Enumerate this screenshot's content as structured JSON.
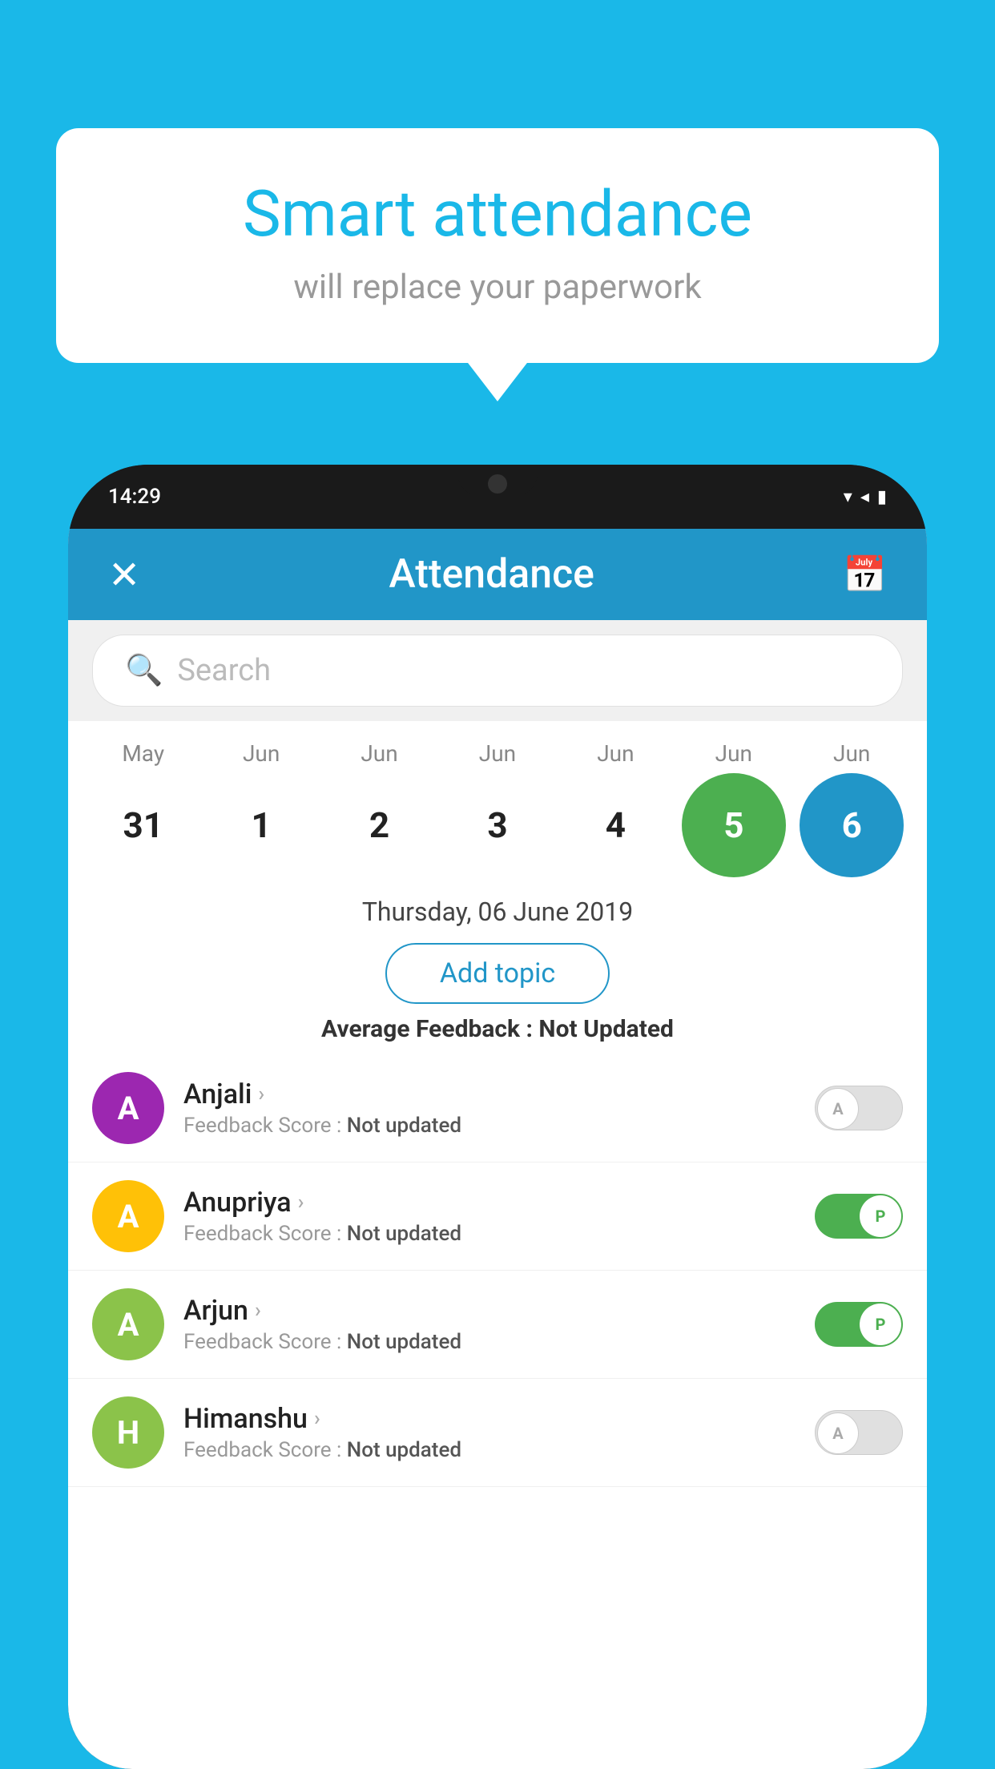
{
  "background_color": "#1ab8e8",
  "speech_bubble": {
    "title": "Smart attendance",
    "subtitle": "will replace your paperwork"
  },
  "status_bar": {
    "time": "14:29",
    "icons": "▼◀█"
  },
  "app_header": {
    "title": "Attendance",
    "close_label": "✕",
    "calendar_icon": "📅"
  },
  "search": {
    "placeholder": "Search"
  },
  "calendar": {
    "months": [
      "May",
      "Jun",
      "Jun",
      "Jun",
      "Jun",
      "Jun",
      "Jun"
    ],
    "dates": [
      "31",
      "1",
      "2",
      "3",
      "4",
      "5",
      "6"
    ],
    "states": [
      "normal",
      "normal",
      "normal",
      "normal",
      "normal",
      "today",
      "selected"
    ]
  },
  "selected_date": "Thursday, 06 June 2019",
  "add_topic_label": "Add topic",
  "average_feedback": {
    "label": "Average Feedback : ",
    "value": "Not Updated"
  },
  "students": [
    {
      "name": "Anjali",
      "initial": "A",
      "avatar_color": "#9c27b0",
      "feedback_label": "Feedback Score : ",
      "feedback_value": "Not updated",
      "toggle": "off",
      "toggle_letter": "A"
    },
    {
      "name": "Anupriya",
      "initial": "A",
      "avatar_color": "#ffc107",
      "feedback_label": "Feedback Score : ",
      "feedback_value": "Not updated",
      "toggle": "on",
      "toggle_letter": "P"
    },
    {
      "name": "Arjun",
      "initial": "A",
      "avatar_color": "#8bc34a",
      "feedback_label": "Feedback Score : ",
      "feedback_value": "Not updated",
      "toggle": "on",
      "toggle_letter": "P"
    },
    {
      "name": "Himanshu",
      "initial": "H",
      "avatar_color": "#8bc34a",
      "feedback_label": "Feedback Score : ",
      "feedback_value": "Not updated",
      "toggle": "off",
      "toggle_letter": "A"
    }
  ]
}
